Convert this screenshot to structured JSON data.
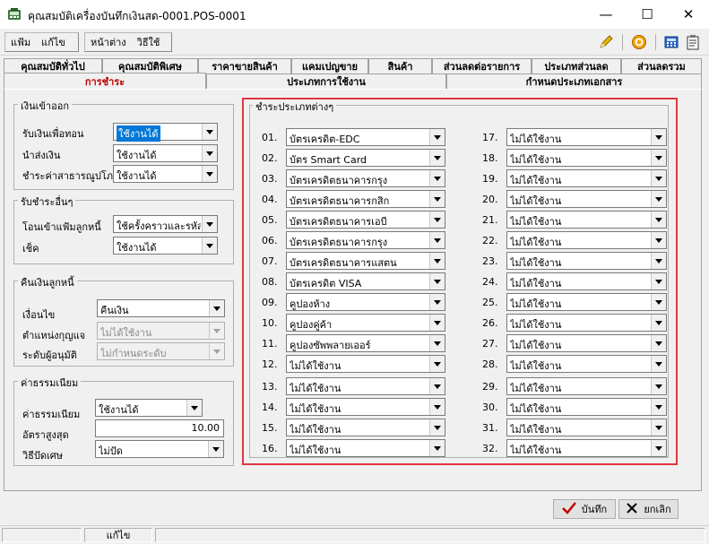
{
  "window": {
    "title": "คุณสมบัติเครื่องบันทึกเงินสด-0001.POS-0001",
    "minimize": "—",
    "maximize": "☐",
    "close": "✕"
  },
  "menu": {
    "group1": [
      "แฟ้ม",
      "แก้ไข"
    ],
    "group2": [
      "หน้าต่าง",
      "วิธีใช้"
    ]
  },
  "tabs_row1": [
    "คุณสมบัติทั่วไป",
    "คุณสมบัติพิเศษ",
    "ราคาขายสินค้า",
    "แคมเปญขาย",
    "สินค้า",
    "ส่วนลดต่อรายการ",
    "ประเภทส่วนลด",
    "ส่วนลดรวม"
  ],
  "tabs_row2": [
    "การชำระ",
    "ประเภทการใช้งาน",
    "กำหนดประเภทเอกสาร"
  ],
  "active_tab": "การชำระ",
  "income_group": {
    "title": "เงินเข้าออก",
    "rows": [
      {
        "label": "รับเงินเพื่อทอน",
        "value": "ใช้งานได้"
      },
      {
        "label": "นำส่งเงิน",
        "value": "ใช้งานได้"
      },
      {
        "label": "ชำระค่าสาธารณูปโภค",
        "value": "ใช้งานได้"
      }
    ]
  },
  "other_payment_group": {
    "title": "รับชำระอื่นๆ",
    "rows": [
      {
        "label": "โอนเข้าแฟ้มลูกหนี้",
        "value": "ใช้ครั้งคราวและรหัสถูก"
      },
      {
        "label": "เช็ค",
        "value": "ใช้งานได้"
      }
    ]
  },
  "refund_group": {
    "title": "คืนเงินลูกหนี้",
    "rows": [
      {
        "label": "เงื่อนไข",
        "value": "คืนเงิน"
      },
      {
        "label": "ตำแหน่งกุญแจ",
        "value": "ไม่ได้ใช้งาน"
      },
      {
        "label": "ระดับผู้อนุมัติ",
        "value": "ไม่กำหนดระดับ"
      }
    ]
  },
  "fee_group": {
    "title": "ค่าธรรมเนียม",
    "fee_label": "ค่าธรรมเนียม",
    "fee_value": "ใช้งานได้",
    "max_rate_label": "อัตราสูงสุด",
    "max_rate_value": "10.00",
    "rounding_label": "วิธีปัดเศษ",
    "rounding_value": "ไม่ปัด"
  },
  "payment_types_group": {
    "title": "ชำระประเภทต่างๆ",
    "left": [
      {
        "num": "01.",
        "value": "บัตรเครดิต-EDC"
      },
      {
        "num": "02.",
        "value": "บัตร Smart Card"
      },
      {
        "num": "03.",
        "value": "บัตรเครดิตธนาคารกรุง"
      },
      {
        "num": "04.",
        "value": "บัตรเครดิตธนาคารกสิก"
      },
      {
        "num": "05.",
        "value": "บัตรเครดิตธนาคารเอบี"
      },
      {
        "num": "06.",
        "value": "บัตรเครดิตธนาคารกรุง"
      },
      {
        "num": "07.",
        "value": "บัตรเครดิตธนาคารแสตน"
      },
      {
        "num": "08.",
        "value": "บัตรเครดิต VISA"
      },
      {
        "num": "09.",
        "value": "คูปองห้าง"
      },
      {
        "num": "10.",
        "value": "คูปองคู่ค้า"
      },
      {
        "num": "11.",
        "value": "คูปองซัพพลายเออร์"
      },
      {
        "num": "12.",
        "value": "ไม่ได้ใช้งาน"
      },
      {
        "num": "13.",
        "value": "ไม่ได้ใช้งาน"
      },
      {
        "num": "14.",
        "value": "ไม่ได้ใช้งาน"
      },
      {
        "num": "15.",
        "value": "ไม่ได้ใช้งาน"
      },
      {
        "num": "16.",
        "value": "ไม่ได้ใช้งาน"
      }
    ],
    "right": [
      {
        "num": "17.",
        "value": "ไม่ได้ใช้งาน"
      },
      {
        "num": "18.",
        "value": "ไม่ได้ใช้งาน"
      },
      {
        "num": "19.",
        "value": "ไม่ได้ใช้งาน"
      },
      {
        "num": "20.",
        "value": "ไม่ได้ใช้งาน"
      },
      {
        "num": "21.",
        "value": "ไม่ได้ใช้งาน"
      },
      {
        "num": "22.",
        "value": "ไม่ได้ใช้งาน"
      },
      {
        "num": "23.",
        "value": "ไม่ได้ใช้งาน"
      },
      {
        "num": "24.",
        "value": "ไม่ได้ใช้งาน"
      },
      {
        "num": "25.",
        "value": "ไม่ได้ใช้งาน"
      },
      {
        "num": "26.",
        "value": "ไม่ได้ใช้งาน"
      },
      {
        "num": "27.",
        "value": "ไม่ได้ใช้งาน"
      },
      {
        "num": "28.",
        "value": "ไม่ได้ใช้งาน"
      },
      {
        "num": "29.",
        "value": "ไม่ได้ใช้งาน"
      },
      {
        "num": "30.",
        "value": "ไม่ได้ใช้งาน"
      },
      {
        "num": "31.",
        "value": "ไม่ได้ใช้งาน"
      },
      {
        "num": "32.",
        "value": "ไม่ได้ใช้งาน"
      }
    ]
  },
  "buttons": {
    "save": "บันทึก",
    "cancel": "ยกเลิก"
  },
  "status": {
    "mode": "แก้ไข"
  },
  "colors": {
    "highlight": "#e2363f",
    "active_tab_text": "#c00000",
    "selection": "#0078d7"
  },
  "icons": [
    "app-icon",
    "pencil-icon",
    "target-icon",
    "calculator-icon",
    "clipboard-icon",
    "checkmark-icon",
    "x-icon",
    "dropdown-arrow-icon"
  ]
}
